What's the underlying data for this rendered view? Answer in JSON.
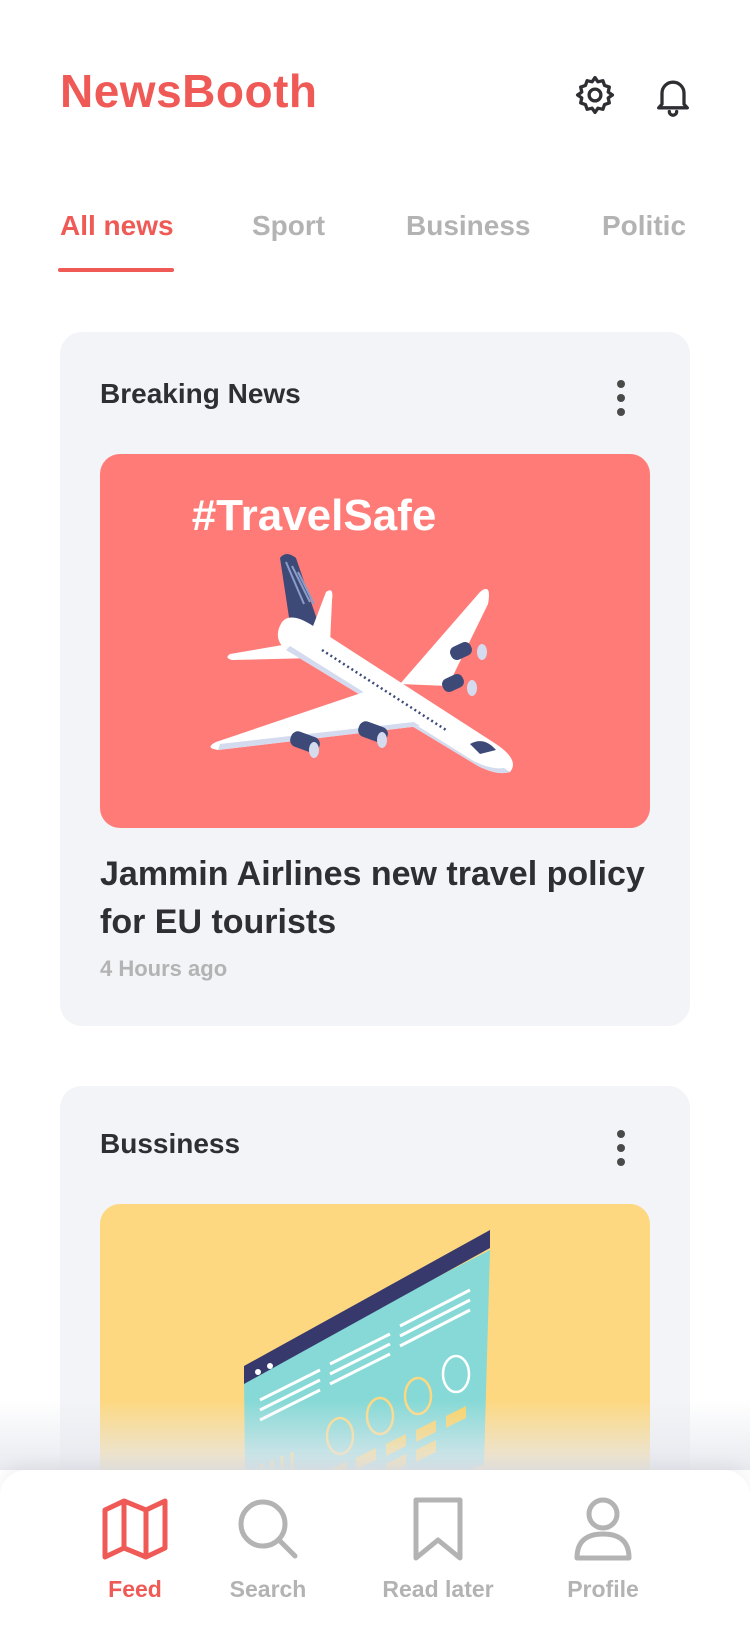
{
  "app": {
    "title": "NewsBooth",
    "accent_color": "#ef5a56"
  },
  "header": {
    "icons": [
      "gear-icon",
      "bell-icon"
    ]
  },
  "tabs": [
    {
      "label": "All news",
      "active": true
    },
    {
      "label": "Sport",
      "active": false
    },
    {
      "label": "Business",
      "active": false
    },
    {
      "label": "Politic",
      "active": false
    }
  ],
  "cards": [
    {
      "category": "Breaking News",
      "image_caption": "#TravelSafe",
      "image_bg": "#ff7b77",
      "headline": "Jammin Airlines new travel policy for EU tourists",
      "time": "4 Hours ago"
    },
    {
      "category": "Bussiness",
      "image_bg": "#fdd880"
    }
  ],
  "bottom_nav": [
    {
      "label": "Feed",
      "icon": "map-icon",
      "active": true
    },
    {
      "label": "Search",
      "icon": "search-icon",
      "active": false
    },
    {
      "label": "Read later",
      "icon": "bookmark-icon",
      "active": false
    },
    {
      "label": "Profile",
      "icon": "profile-icon",
      "active": false
    }
  ]
}
